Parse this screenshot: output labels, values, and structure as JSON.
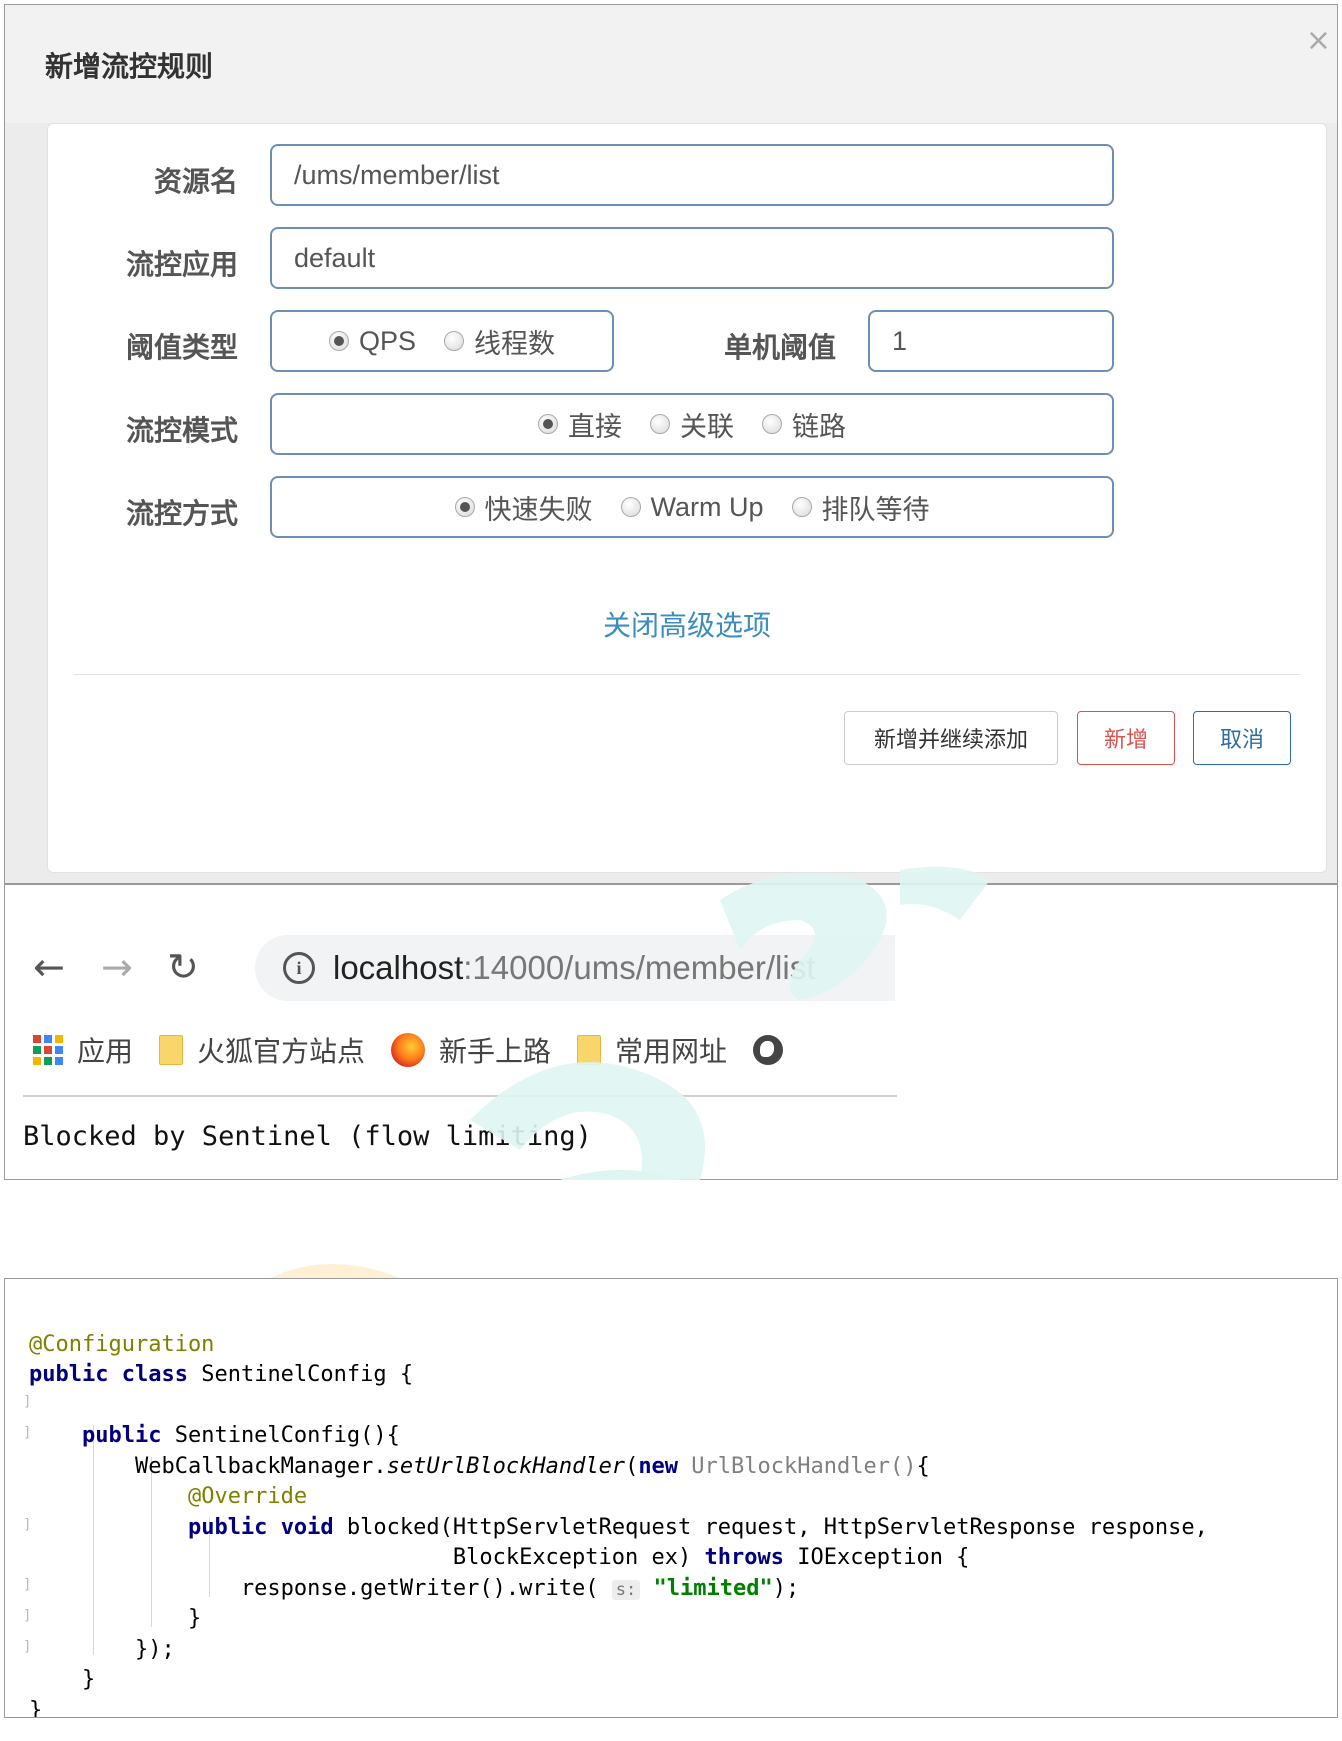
{
  "dialog": {
    "title": "新增流控规则",
    "close": "×",
    "resource_label": "资源名",
    "resource_value": "/ums/member/list",
    "app_label": "流控应用",
    "app_value": "default",
    "threshold_type_label": "阈值类型",
    "threshold_type_options": [
      "QPS",
      "线程数"
    ],
    "single_threshold_label": "单机阈值",
    "single_threshold_value": "1",
    "mode_label": "流控模式",
    "mode_options": [
      "直接",
      "关联",
      "链路"
    ],
    "effect_label": "流控方式",
    "effect_options": [
      "快速失败",
      "Warm Up",
      "排队等待"
    ],
    "advanced_link": "关闭高级选项",
    "btn_add_continue": "新增并继续添加",
    "btn_add": "新增",
    "btn_cancel": "取消"
  },
  "browser": {
    "url_host": "localhost",
    "url_rest": ":14000/ums/member/list",
    "bookmarks": [
      "应用",
      "火狐官方站点",
      "新手上路",
      "常用网址"
    ],
    "content": "Blocked by Sentinel (flow limiting)"
  },
  "code": {
    "annotation": "@Configuration",
    "kw_public": "public",
    "kw_class": "class",
    "class_name": " SentinelConfig {",
    "ctor": " SentinelConfig(){",
    "manager": "WebCallbackManager.",
    "method": "setUrlBlockHandler",
    "paren_open": "(",
    "kw_new": "new",
    "handler": " UrlBlockHandler()",
    "brace_open": "{",
    "override": "@Override",
    "kw_void": "void",
    "blocked_sig": " blocked(HttpServletRequest request, HttpServletResponse response,",
    "blocked_sig2": "BlockException ex) ",
    "kw_throws": "throws",
    "ioexception": " IOException {",
    "write_call": "response.getWriter().write( ",
    "hint": "s:",
    "string": "\"limited\"",
    "write_end": ");",
    "close1": "}",
    "close2": "});",
    "close3": "}",
    "close4": "}"
  }
}
